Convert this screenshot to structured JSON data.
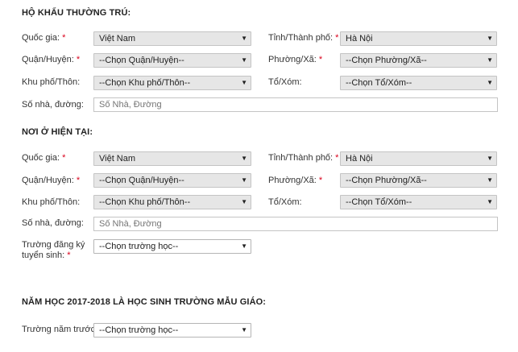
{
  "permanent": {
    "title": "HỘ KHẨU THƯỜNG TRÚ:",
    "country_label": "Quốc gia:",
    "country_value": "Việt Nam",
    "province_label": "Tỉnh/Thành phố:",
    "province_value": "Hà Nội",
    "district_label": "Quận/Huyện:",
    "district_value": "--Chọn Quận/Huyện--",
    "ward_label": "Phường/Xã:",
    "ward_value": "--Chọn Phường/Xã--",
    "quarter_label": "Khu phố/Thôn:",
    "quarter_value": "--Chọn Khu phố/Thôn--",
    "group_label": "Tổ/Xóm:",
    "group_value": "--Chọn Tổ/Xóm--",
    "street_label": "Số nhà, đường:",
    "street_placeholder": "Số Nhà, Đường"
  },
  "current": {
    "title": "NƠI Ở HIỆN TẠI:",
    "country_label": "Quốc gia:",
    "country_value": "Việt Nam",
    "province_label": "Tỉnh/Thành phố:",
    "province_value": "Hà Nội",
    "district_label": "Quận/Huyện:",
    "district_value": "--Chọn Quận/Huyện--",
    "ward_label": "Phường/Xã:",
    "ward_value": "--Chọn Phường/Xã--",
    "quarter_label": "Khu phố/Thôn:",
    "quarter_value": "--Chọn Khu phố/Thôn--",
    "group_label": "Tổ/Xóm:",
    "group_value": "--Chọn Tổ/Xóm--",
    "street_label": "Số nhà, đường:",
    "street_placeholder": "Số Nhà, Đường",
    "school_label_line1": "Trường đăng ký",
    "school_label_line2": "tuyển sinh:",
    "school_value": "--Chọn trường học--"
  },
  "preschool": {
    "title": "NĂM HỌC 2017-2018 LÀ HỌC SINH TRƯỜNG MẪU GIÁO:",
    "prev_school_label": "Trường năm trước:",
    "prev_school_value": "--Chọn trường học--"
  },
  "common": {
    "required_mark": "*",
    "arrow_glyph": "▼"
  }
}
